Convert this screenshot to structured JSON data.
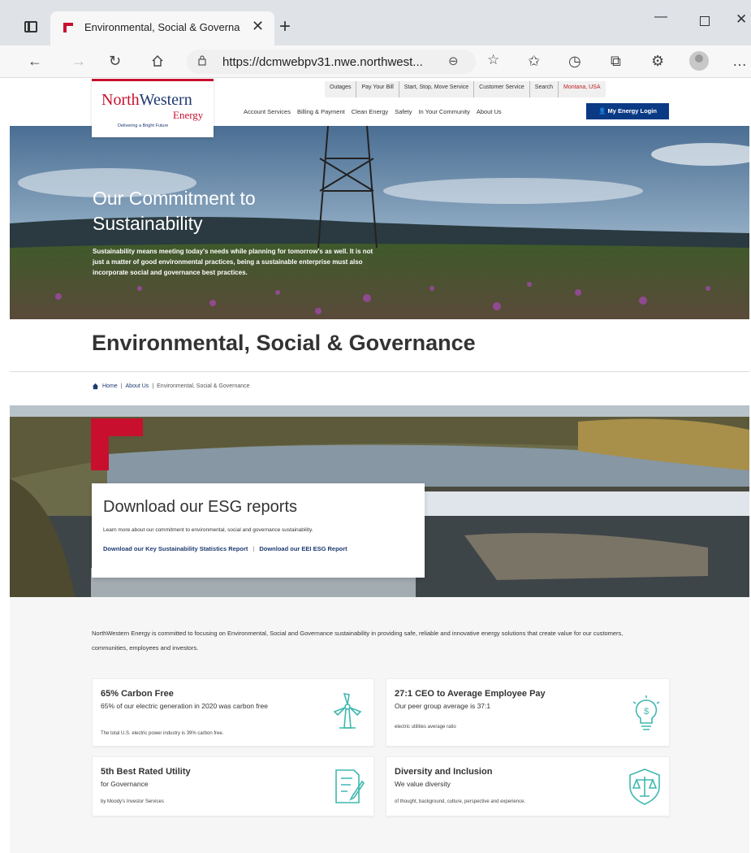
{
  "browser": {
    "tab_title": "Environmental, Social & Governa",
    "url": "https://dcmwebpv31.nwe.northwest...",
    "new_tab": "+",
    "close": "✕"
  },
  "utility_nav": [
    "Outages",
    "Pay Your Bill",
    "Start, Stop, Move Service",
    "Customer Service",
    "Search",
    "Montana, USA"
  ],
  "logo": {
    "brand_north": "North",
    "brand_western": "Western",
    "brand_energy": "Energy",
    "tagline": "Delivering a Bright Future"
  },
  "main_nav": [
    "Account Services",
    "Billing & Payment",
    "Clean Energy",
    "Safety",
    "In Your Community",
    "About Us"
  ],
  "login_label": "My Energy Login",
  "hero": {
    "title": "Our Commitment to Sustainability",
    "text": "Sustainability means meeting today's needs while planning for tomorrow's as well. It is not just a matter of good environmental practices, being a sustainable enterprise must also incorporate social and governance best practices."
  },
  "page_heading": "Environmental, Social & Governance",
  "breadcrumb": {
    "home": "Home",
    "about": "About Us",
    "current": "Environmental, Social & Governance"
  },
  "reports": {
    "title": "Download our ESG reports",
    "text": "Learn more about our commitment to environmental, social and governance sustainability.",
    "link1": "Download our Key Sustainability Statistics Report",
    "separator": "|",
    "link2": "Download our EEI ESG Report"
  },
  "intro": "NorthWestern Energy is committed to focusing on Environmental, Social and Governance sustainability in providing safe, reliable and innovative energy solutions that create value for our customers, communities, employees and investors.",
  "stats": [
    {
      "title": "65% Carbon Free",
      "sub": "65% of our electric generation in 2020 was carbon free",
      "note": "The total U.S. electric power industry is 39% carbon free.",
      "icon": "wind-turbine-icon"
    },
    {
      "title": "27:1 CEO to Average Employee Pay",
      "sub": "Our peer group average is 37:1",
      "note": "electric utilities average ratio",
      "icon": "lightbulb-dollar-icon"
    },
    {
      "title": "5th Best Rated Utility",
      "sub": "for Governance",
      "note": "by Moody's Investor Services",
      "icon": "document-pen-icon"
    },
    {
      "title": "Diversity and Inclusion",
      "sub": "We value diversity",
      "note": "of thought, background, culture, perspective and experience.",
      "icon": "shield-scales-icon"
    }
  ],
  "colors": {
    "brand_red": "#c8102e",
    "brand_navy": "#1e3a70",
    "login_blue": "#0b3a85",
    "icon_teal": "#3fb8b0"
  }
}
